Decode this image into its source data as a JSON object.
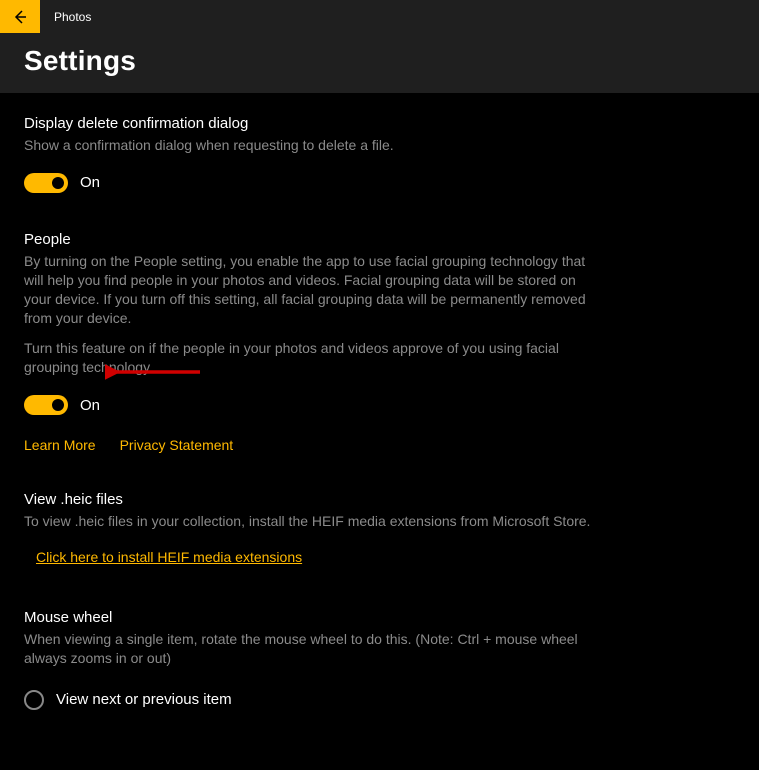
{
  "app": {
    "title": "Photos"
  },
  "header": {
    "title": "Settings"
  },
  "sections": {
    "delete": {
      "label": "Display delete confirmation dialog",
      "desc": "Show a confirmation dialog when requesting to delete a file.",
      "toggle_state": "On"
    },
    "people": {
      "label": "People",
      "desc": "By turning on the People setting, you enable the app to use facial grouping technology that will help you find people in your photos and videos. Facial grouping data will be stored on your device. If you turn off this setting, all facial grouping data will be permanently removed from your device.",
      "desc2": "Turn this feature on if the people in your photos and videos approve of you using facial grouping technology.",
      "toggle_state": "On",
      "learn_more": "Learn More",
      "privacy": "Privacy Statement"
    },
    "heic": {
      "label": "View .heic files",
      "desc": "To view .heic files in your collection, install the HEIF media extensions from Microsoft Store.",
      "link": "Click here to install HEIF media extensions"
    },
    "mouse": {
      "label": "Mouse wheel",
      "desc": "When viewing a single item, rotate the mouse wheel to do this. (Note: Ctrl + mouse wheel always zooms in or out)",
      "option1": "View next or previous item"
    }
  },
  "colors": {
    "accent": "#ffb900"
  }
}
